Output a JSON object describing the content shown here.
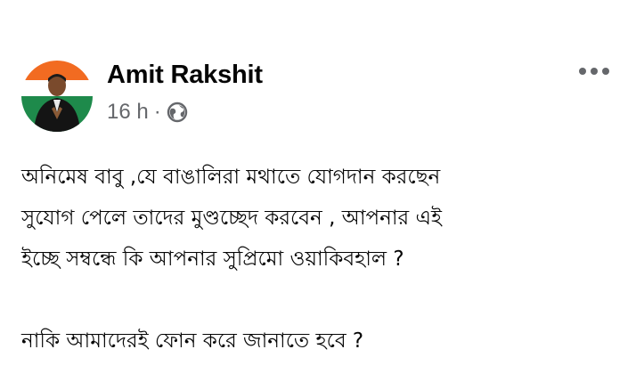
{
  "post": {
    "author": {
      "name": "Amit Rakshit"
    },
    "meta": {
      "time": "16 h",
      "separator": "·",
      "audience_icon": "globe-icon"
    },
    "more_icon": "more-horizontal-icon",
    "text": {
      "paragraph1": [
        "অনিমেষ বাবু ,যে বাঙালিরা মথাতে যোগদান করছেন",
        "সুযোগ পেলে তাদের  মুণ্ডচ্ছেদ করবেন , আপনার এই",
        "ইচ্ছে সম্বন্ধে কি আপনার সুপ্রিমো ওয়াকিবহাল ?"
      ],
      "paragraph2": [
        "নাকি আমাদেরই ফোন করে জানাতে হবে ?"
      ]
    }
  },
  "colors": {
    "text": "#050505",
    "secondary_text": "#65676b",
    "background": "#ffffff"
  }
}
